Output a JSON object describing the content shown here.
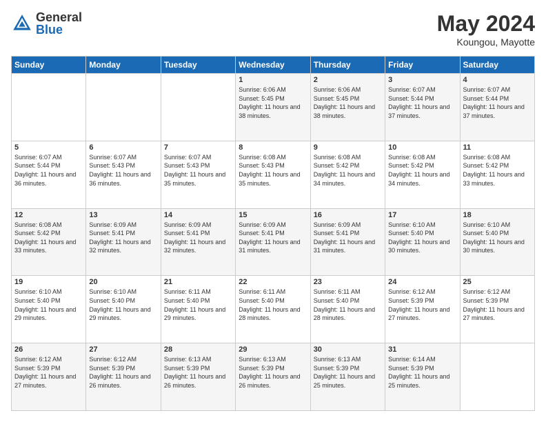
{
  "logo": {
    "general": "General",
    "blue": "Blue"
  },
  "header": {
    "month": "May 2024",
    "location": "Koungou, Mayotte"
  },
  "days_of_week": [
    "Sunday",
    "Monday",
    "Tuesday",
    "Wednesday",
    "Thursday",
    "Friday",
    "Saturday"
  ],
  "weeks": [
    [
      {
        "day": "",
        "sunrise": "",
        "sunset": "",
        "daylight": ""
      },
      {
        "day": "",
        "sunrise": "",
        "sunset": "",
        "daylight": ""
      },
      {
        "day": "",
        "sunrise": "",
        "sunset": "",
        "daylight": ""
      },
      {
        "day": "1",
        "sunrise": "Sunrise: 6:06 AM",
        "sunset": "Sunset: 5:45 PM",
        "daylight": "Daylight: 11 hours and 38 minutes."
      },
      {
        "day": "2",
        "sunrise": "Sunrise: 6:06 AM",
        "sunset": "Sunset: 5:45 PM",
        "daylight": "Daylight: 11 hours and 38 minutes."
      },
      {
        "day": "3",
        "sunrise": "Sunrise: 6:07 AM",
        "sunset": "Sunset: 5:44 PM",
        "daylight": "Daylight: 11 hours and 37 minutes."
      },
      {
        "day": "4",
        "sunrise": "Sunrise: 6:07 AM",
        "sunset": "Sunset: 5:44 PM",
        "daylight": "Daylight: 11 hours and 37 minutes."
      }
    ],
    [
      {
        "day": "5",
        "sunrise": "Sunrise: 6:07 AM",
        "sunset": "Sunset: 5:44 PM",
        "daylight": "Daylight: 11 hours and 36 minutes."
      },
      {
        "day": "6",
        "sunrise": "Sunrise: 6:07 AM",
        "sunset": "Sunset: 5:43 PM",
        "daylight": "Daylight: 11 hours and 36 minutes."
      },
      {
        "day": "7",
        "sunrise": "Sunrise: 6:07 AM",
        "sunset": "Sunset: 5:43 PM",
        "daylight": "Daylight: 11 hours and 35 minutes."
      },
      {
        "day": "8",
        "sunrise": "Sunrise: 6:08 AM",
        "sunset": "Sunset: 5:43 PM",
        "daylight": "Daylight: 11 hours and 35 minutes."
      },
      {
        "day": "9",
        "sunrise": "Sunrise: 6:08 AM",
        "sunset": "Sunset: 5:42 PM",
        "daylight": "Daylight: 11 hours and 34 minutes."
      },
      {
        "day": "10",
        "sunrise": "Sunrise: 6:08 AM",
        "sunset": "Sunset: 5:42 PM",
        "daylight": "Daylight: 11 hours and 34 minutes."
      },
      {
        "day": "11",
        "sunrise": "Sunrise: 6:08 AM",
        "sunset": "Sunset: 5:42 PM",
        "daylight": "Daylight: 11 hours and 33 minutes."
      }
    ],
    [
      {
        "day": "12",
        "sunrise": "Sunrise: 6:08 AM",
        "sunset": "Sunset: 5:42 PM",
        "daylight": "Daylight: 11 hours and 33 minutes."
      },
      {
        "day": "13",
        "sunrise": "Sunrise: 6:09 AM",
        "sunset": "Sunset: 5:41 PM",
        "daylight": "Daylight: 11 hours and 32 minutes."
      },
      {
        "day": "14",
        "sunrise": "Sunrise: 6:09 AM",
        "sunset": "Sunset: 5:41 PM",
        "daylight": "Daylight: 11 hours and 32 minutes."
      },
      {
        "day": "15",
        "sunrise": "Sunrise: 6:09 AM",
        "sunset": "Sunset: 5:41 PM",
        "daylight": "Daylight: 11 hours and 31 minutes."
      },
      {
        "day": "16",
        "sunrise": "Sunrise: 6:09 AM",
        "sunset": "Sunset: 5:41 PM",
        "daylight": "Daylight: 11 hours and 31 minutes."
      },
      {
        "day": "17",
        "sunrise": "Sunrise: 6:10 AM",
        "sunset": "Sunset: 5:40 PM",
        "daylight": "Daylight: 11 hours and 30 minutes."
      },
      {
        "day": "18",
        "sunrise": "Sunrise: 6:10 AM",
        "sunset": "Sunset: 5:40 PM",
        "daylight": "Daylight: 11 hours and 30 minutes."
      }
    ],
    [
      {
        "day": "19",
        "sunrise": "Sunrise: 6:10 AM",
        "sunset": "Sunset: 5:40 PM",
        "daylight": "Daylight: 11 hours and 29 minutes."
      },
      {
        "day": "20",
        "sunrise": "Sunrise: 6:10 AM",
        "sunset": "Sunset: 5:40 PM",
        "daylight": "Daylight: 11 hours and 29 minutes."
      },
      {
        "day": "21",
        "sunrise": "Sunrise: 6:11 AM",
        "sunset": "Sunset: 5:40 PM",
        "daylight": "Daylight: 11 hours and 29 minutes."
      },
      {
        "day": "22",
        "sunrise": "Sunrise: 6:11 AM",
        "sunset": "Sunset: 5:40 PM",
        "daylight": "Daylight: 11 hours and 28 minutes."
      },
      {
        "day": "23",
        "sunrise": "Sunrise: 6:11 AM",
        "sunset": "Sunset: 5:40 PM",
        "daylight": "Daylight: 11 hours and 28 minutes."
      },
      {
        "day": "24",
        "sunrise": "Sunrise: 6:12 AM",
        "sunset": "Sunset: 5:39 PM",
        "daylight": "Daylight: 11 hours and 27 minutes."
      },
      {
        "day": "25",
        "sunrise": "Sunrise: 6:12 AM",
        "sunset": "Sunset: 5:39 PM",
        "daylight": "Daylight: 11 hours and 27 minutes."
      }
    ],
    [
      {
        "day": "26",
        "sunrise": "Sunrise: 6:12 AM",
        "sunset": "Sunset: 5:39 PM",
        "daylight": "Daylight: 11 hours and 27 minutes."
      },
      {
        "day": "27",
        "sunrise": "Sunrise: 6:12 AM",
        "sunset": "Sunset: 5:39 PM",
        "daylight": "Daylight: 11 hours and 26 minutes."
      },
      {
        "day": "28",
        "sunrise": "Sunrise: 6:13 AM",
        "sunset": "Sunset: 5:39 PM",
        "daylight": "Daylight: 11 hours and 26 minutes."
      },
      {
        "day": "29",
        "sunrise": "Sunrise: 6:13 AM",
        "sunset": "Sunset: 5:39 PM",
        "daylight": "Daylight: 11 hours and 26 minutes."
      },
      {
        "day": "30",
        "sunrise": "Sunrise: 6:13 AM",
        "sunset": "Sunset: 5:39 PM",
        "daylight": "Daylight: 11 hours and 25 minutes."
      },
      {
        "day": "31",
        "sunrise": "Sunrise: 6:14 AM",
        "sunset": "Sunset: 5:39 PM",
        "daylight": "Daylight: 11 hours and 25 minutes."
      },
      {
        "day": "",
        "sunrise": "",
        "sunset": "",
        "daylight": ""
      }
    ]
  ]
}
